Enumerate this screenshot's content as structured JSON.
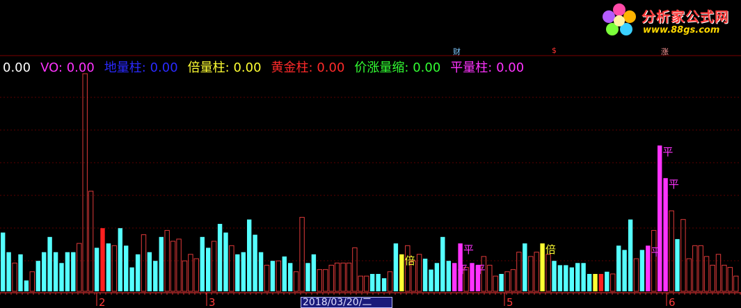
{
  "logo": {
    "title": "分析家公式网",
    "url": "www.88gs.com"
  },
  "legend": [
    {
      "label": "",
      "value": "0.00",
      "color": "#ffffff"
    },
    {
      "label": "VO:",
      "value": "0.00",
      "color": "#ff33ff"
    },
    {
      "label": "地量柱:",
      "value": "0.00",
      "color": "#2a2aff"
    },
    {
      "label": "倍量柱:",
      "value": "0.00",
      "color": "#ffff33"
    },
    {
      "label": "黄金柱:",
      "value": "0.00",
      "color": "#ff2a2a"
    },
    {
      "label": "价涨量缩:",
      "value": "0.00",
      "color": "#33ff33"
    },
    {
      "label": "平量柱:",
      "value": "0.00",
      "color": "#ff33ff"
    }
  ],
  "event_tags": [
    {
      "text": "财",
      "color": "#7fc8ff"
    },
    {
      "text": "$",
      "color": "#ff3333"
    },
    {
      "text": "涨",
      "color": "#ff9999"
    }
  ],
  "x_axis": {
    "month_labels": [
      "2",
      "3",
      "5",
      "6"
    ],
    "cursor_date": "2018/03/20/二"
  },
  "colors": {
    "background": "#000000",
    "up_outline": "#e03a3a",
    "down_fill": "#55ffff",
    "double": "#ffff33",
    "gold": "#ff2020",
    "price_up_vol_down": "#33ff33",
    "flat": "#ff33ff",
    "low": "#2a2aff",
    "grid": "#7a0000"
  },
  "chart_data": {
    "type": "bar",
    "title": "",
    "ylim": [
      0,
      100
    ],
    "bar_kinds": {
      "u": "up-outline",
      "d": "down-solid",
      "b": "double-volume",
      "g": "golden",
      "j": "price-up-volume-down",
      "p": "flat-volume",
      "l": "low-volume"
    },
    "values": [
      27,
      18,
      13,
      17,
      5,
      9,
      14,
      18,
      25,
      18,
      13,
      18,
      18,
      22,
      100,
      46,
      20,
      29,
      22,
      21,
      29,
      21,
      11,
      17,
      26,
      18,
      14,
      25,
      28,
      23,
      24,
      14,
      17,
      15,
      25,
      20,
      23,
      31,
      27,
      21,
      17,
      18,
      33,
      26,
      18,
      12,
      14,
      14,
      16,
      13,
      9,
      34,
      13,
      17,
      10,
      10,
      12,
      13,
      13,
      13,
      20,
      7,
      7,
      8,
      8,
      6,
      9,
      22,
      17,
      21,
      14,
      17,
      15,
      10,
      13,
      25,
      14,
      13,
      22,
      11,
      13,
      12,
      16,
      12,
      7,
      8,
      9,
      10,
      18,
      22,
      16,
      18,
      22,
      17,
      14,
      12,
      12,
      11,
      13,
      13,
      8,
      8,
      8,
      9,
      8,
      21,
      19,
      33,
      15,
      19,
      21,
      28,
      67,
      52,
      37,
      24,
      33,
      15,
      21,
      21,
      16,
      12,
      17,
      12,
      11,
      7
    ]
  }
}
